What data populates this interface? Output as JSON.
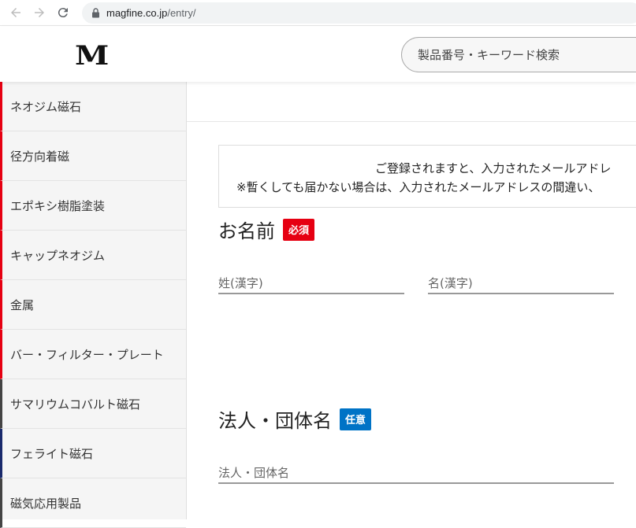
{
  "browser": {
    "url_host": "magfine.co.jp",
    "url_path": "/entry/"
  },
  "header": {
    "logo": "M",
    "search_placeholder": "製品番号・キーワード検索"
  },
  "sidebar": {
    "items": [
      {
        "label": "ネオジム磁石"
      },
      {
        "label": "径方向着磁"
      },
      {
        "label": "エポキシ樹脂塗装"
      },
      {
        "label": "キャップネオジム"
      },
      {
        "label": "金属"
      },
      {
        "label": "バー・フィルター・プレート"
      },
      {
        "label": "サマリウムコバルト磁石"
      },
      {
        "label": "フェライト磁石"
      },
      {
        "label": "磁気応用製品"
      }
    ]
  },
  "notice": {
    "line1": "ご登録されますと、入力されたメールアドレ",
    "line2": "※暫くしても届かない場合は、入力されたメールアドレスの間違い、"
  },
  "form": {
    "name_section": {
      "title": "お名前",
      "badge": "必須",
      "last_name_placeholder": "姓(漢字)",
      "first_name_placeholder": "名(漢字)"
    },
    "company_section": {
      "title": "法人・団体名",
      "badge": "任意",
      "company_placeholder": "法人・団体名"
    }
  },
  "colors": {
    "required": "#e60012",
    "optional": "#0073c6"
  }
}
